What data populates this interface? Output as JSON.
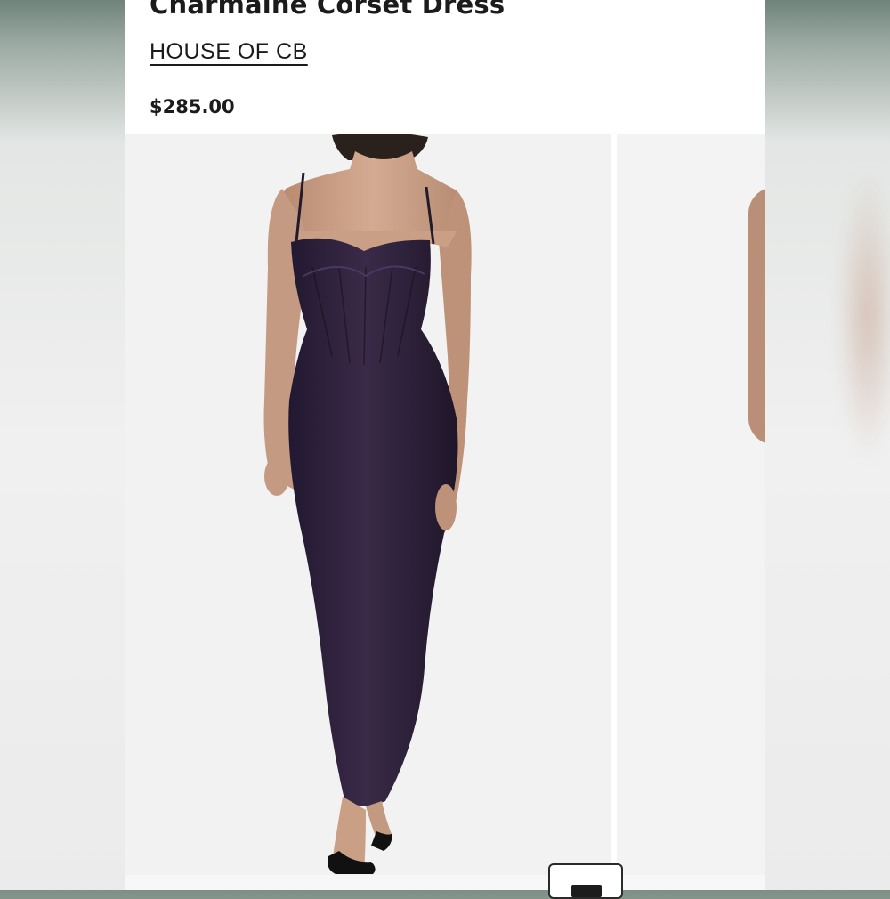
{
  "product": {
    "title": "Charmaine Corset Dress",
    "brand": "HOUSE OF CB",
    "price": "$285.00"
  },
  "gallery": {
    "images": [
      {
        "alt": "model wearing dark purple corset maxi dress"
      },
      {
        "alt": "partial view of next product image"
      }
    ]
  },
  "colors": {
    "dress": "#2e2038",
    "skin": "#c99d83",
    "text": "#1b1b1b"
  }
}
